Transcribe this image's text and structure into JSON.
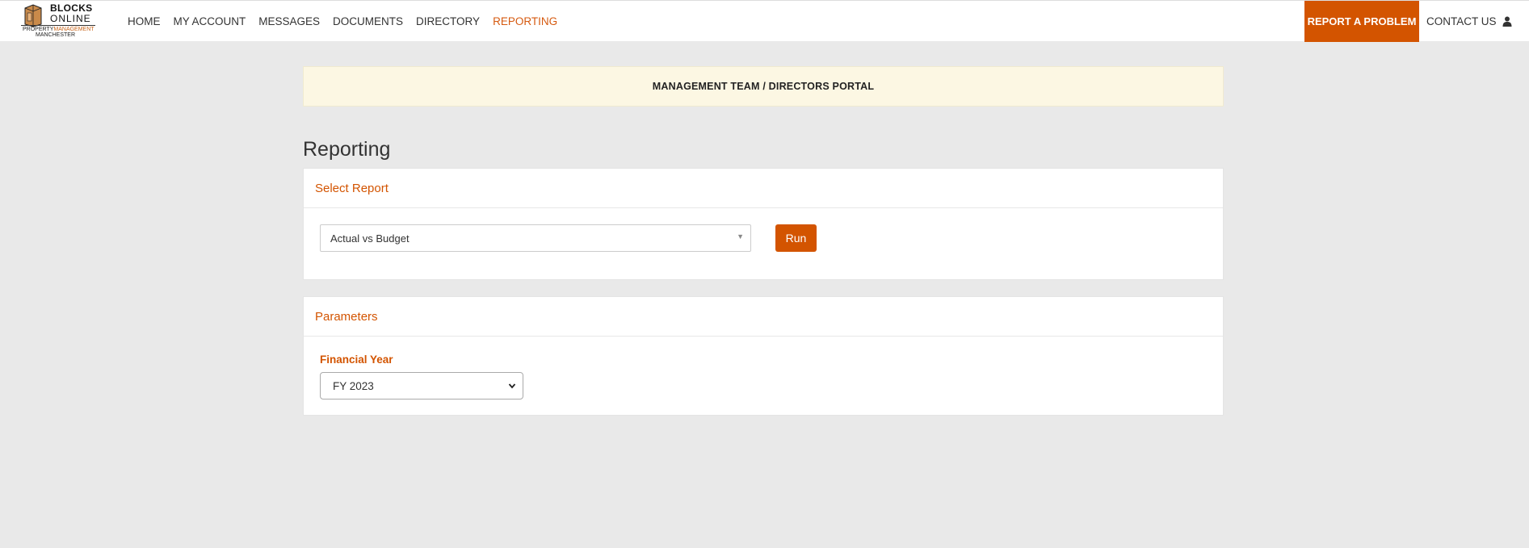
{
  "brand": {
    "line1": "BLOCKS",
    "line2": "ONLINE",
    "sub_a": "PROPERTY",
    "sub_b": "MANAGEMENT",
    "sub_c": "MANCHESTER"
  },
  "nav": {
    "items": [
      "HOME",
      "MY ACCOUNT",
      "MESSAGES",
      "DOCUMENTS",
      "DIRECTORY",
      "REPORTING"
    ],
    "active": "REPORTING",
    "report_problem": "REPORT A PROBLEM",
    "contact": "CONTACT US",
    "user_icon": "user-icon"
  },
  "banner": {
    "text": "MANAGEMENT TEAM / DIRECTORS PORTAL"
  },
  "page": {
    "title": "Reporting"
  },
  "select_report": {
    "heading": "Select Report",
    "selected": "Actual vs Budget",
    "run_label": "Run"
  },
  "parameters": {
    "heading": "Parameters",
    "financial_year_label": "Financial Year",
    "financial_year_value": "FY 2023"
  },
  "colors": {
    "accent": "#d35400",
    "banner_bg": "#fcf7e3",
    "page_bg": "#e9e9e9"
  }
}
